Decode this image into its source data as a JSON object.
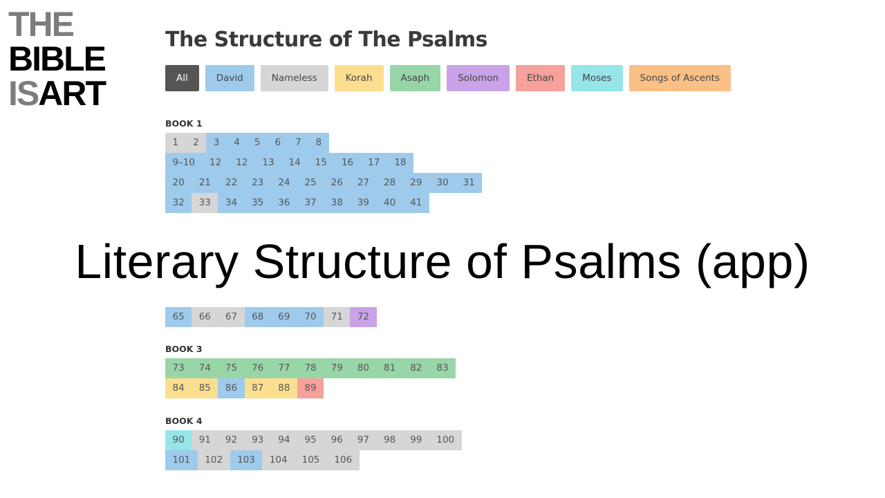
{
  "logo": {
    "line1": "THE",
    "line2": "BIBLE",
    "line3a": "IS",
    "line3b": "ART"
  },
  "header": {
    "title": "The Structure of The Psalms"
  },
  "colors": {
    "all": "#555555",
    "d": "#9ecbec",
    "n": "#d6d6d6",
    "k": "#fbdf8f",
    "a": "#98d6a8",
    "s": "#c9a2e8",
    "e": "#f6a19b",
    "m": "#95e5e9",
    "sa": "#fbc085"
  },
  "filters": [
    {
      "label": "All",
      "key": "all"
    },
    {
      "label": "David",
      "key": "d"
    },
    {
      "label": "Nameless",
      "key": "n"
    },
    {
      "label": "Korah",
      "key": "k"
    },
    {
      "label": "Asaph",
      "key": "a"
    },
    {
      "label": "Solomon",
      "key": "s"
    },
    {
      "label": "Ethan",
      "key": "e"
    },
    {
      "label": "Moses",
      "key": "m"
    },
    {
      "label": "Songs of Ascents",
      "key": "sa"
    }
  ],
  "overlay_caption": "Literary Structure of Psalms (app)",
  "books": [
    {
      "label": "BOOK 1",
      "rows": [
        [
          [
            "1",
            "n"
          ],
          [
            "2",
            "n"
          ],
          [
            "3",
            "d"
          ],
          [
            "4",
            "d"
          ],
          [
            "5",
            "d"
          ],
          [
            "6",
            "d"
          ],
          [
            "7",
            "d"
          ],
          [
            "8",
            "d"
          ]
        ],
        [
          [
            "9–10",
            "d"
          ],
          [
            "12",
            "d"
          ],
          [
            "12",
            "d"
          ],
          [
            "13",
            "d"
          ],
          [
            "14",
            "d"
          ],
          [
            "15",
            "d"
          ],
          [
            "16",
            "d"
          ],
          [
            "17",
            "d"
          ],
          [
            "18",
            "d"
          ]
        ],
        [
          [
            "20",
            "d"
          ],
          [
            "21",
            "d"
          ],
          [
            "22",
            "d"
          ],
          [
            "23",
            "d"
          ],
          [
            "24",
            "d"
          ],
          [
            "25",
            "d"
          ],
          [
            "26",
            "d"
          ],
          [
            "27",
            "d"
          ],
          [
            "28",
            "d"
          ],
          [
            "29",
            "d"
          ],
          [
            "30",
            "d"
          ],
          [
            "31",
            "d"
          ]
        ],
        [
          [
            "32",
            "d"
          ],
          [
            "33",
            "n"
          ],
          [
            "34",
            "d"
          ],
          [
            "35",
            "d"
          ],
          [
            "36",
            "d"
          ],
          [
            "37",
            "d"
          ],
          [
            "38",
            "d"
          ],
          [
            "39",
            "d"
          ],
          [
            "40",
            "d"
          ],
          [
            "41",
            "d"
          ]
        ]
      ]
    },
    {
      "label": "",
      "rows": [
        [
          [
            "65",
            "d"
          ],
          [
            "66",
            "n"
          ],
          [
            "67",
            "n"
          ],
          [
            "68",
            "d"
          ],
          [
            "69",
            "d"
          ],
          [
            "70",
            "d"
          ],
          [
            "71",
            "n"
          ],
          [
            "72",
            "s"
          ]
        ]
      ]
    },
    {
      "label": "BOOK 3",
      "rows": [
        [
          [
            "73",
            "a"
          ],
          [
            "74",
            "a"
          ],
          [
            "75",
            "a"
          ],
          [
            "76",
            "a"
          ],
          [
            "77",
            "a"
          ],
          [
            "78",
            "a"
          ],
          [
            "79",
            "a"
          ],
          [
            "80",
            "a"
          ],
          [
            "81",
            "a"
          ],
          [
            "82",
            "a"
          ],
          [
            "83",
            "a"
          ]
        ],
        [
          [
            "84",
            "k"
          ],
          [
            "85",
            "k"
          ],
          [
            "86",
            "d"
          ],
          [
            "87",
            "k"
          ],
          [
            "88",
            "k"
          ],
          [
            "89",
            "e"
          ]
        ]
      ]
    },
    {
      "label": "BOOK 4",
      "rows": [
        [
          [
            "90",
            "m"
          ],
          [
            "91",
            "n"
          ],
          [
            "92",
            "n"
          ],
          [
            "93",
            "n"
          ],
          [
            "94",
            "n"
          ],
          [
            "95",
            "n"
          ],
          [
            "96",
            "n"
          ],
          [
            "97",
            "n"
          ],
          [
            "98",
            "n"
          ],
          [
            "99",
            "n"
          ],
          [
            "100",
            "n"
          ]
        ],
        [
          [
            "101",
            "d"
          ],
          [
            "102",
            "n"
          ],
          [
            "103",
            "d"
          ],
          [
            "104",
            "n"
          ],
          [
            "105",
            "n"
          ],
          [
            "106",
            "n"
          ]
        ]
      ]
    }
  ]
}
